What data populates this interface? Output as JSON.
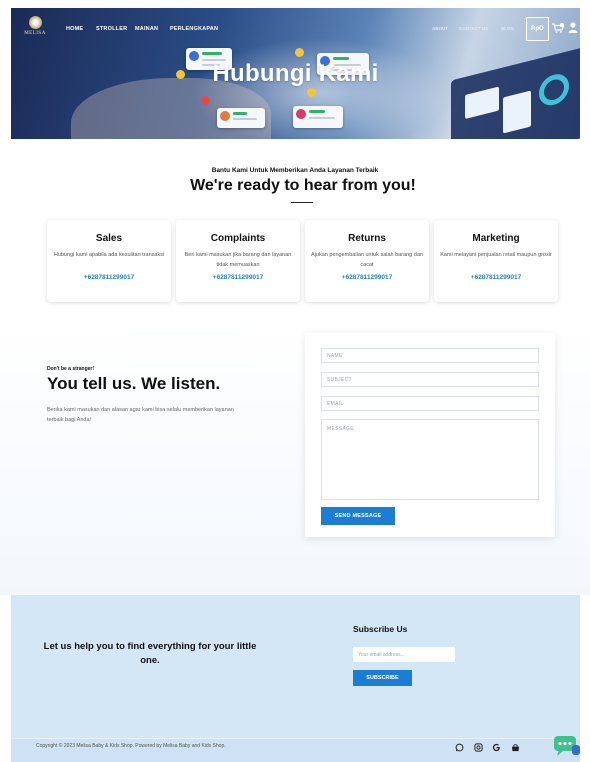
{
  "nav": {
    "logo_text": "MELISA",
    "links": [
      "HOME",
      "STROLLER",
      "MAINAN",
      "PERLENGKAPAN"
    ],
    "right_links": [
      "ABOUT",
      "CONTACT US",
      "BLOG"
    ],
    "lang": "RpO"
  },
  "hero": {
    "title": "Hubungi Kami"
  },
  "intro": {
    "kicker": "Bantu Kami Untuk Memberikan Anda Layanan Terbaik",
    "headline": "We're ready to hear from you!"
  },
  "cards": [
    {
      "title": "Sales",
      "desc": "Hubungi kami apabila ada kesulitan transaksi",
      "phone": "+6287811299017"
    },
    {
      "title": "Complaints",
      "desc": "Beri kami masukan jika barang dan layanan tidak memuaskan",
      "phone": "+6287811299017"
    },
    {
      "title": "Returns",
      "desc": "Ajukan pengembalian untuk salah barang dan cacat",
      "phone": "+6287811299017"
    },
    {
      "title": "Marketing",
      "desc": "Kami melayani penjualan retail maupun grosir",
      "phone": "+6287811299017"
    }
  ],
  "contact": {
    "kicker": "Don't be a stranger!",
    "title": "You tell us. We listen.",
    "desc": "Berika kami masukan dan alasan agar kami bisa selalu memberikan layanan terbaik bagi Anda!"
  },
  "form": {
    "name_placeholder": "NAME",
    "subject_placeholder": "SUBJECT",
    "email_placeholder": "EMAIL",
    "message_placeholder": "MESSAGE",
    "send_label": "SEND MESSAGE"
  },
  "subscribe": {
    "tagline": "Let us help you to find everything for your little one.",
    "title": "Subscribe Us",
    "placeholder": "Your email address...",
    "button": "SUBSCRIBE"
  },
  "footer": {
    "copyright": "Copyright © 2023 Melisa Baby & Kids Shop. Powered by Melisa Baby and Kids Shop."
  },
  "colors": {
    "accent": "#1c7dd3",
    "phone": "#2481c9",
    "subscribe_bg": "#d4e7f7"
  },
  "icons": [
    "cart-icon",
    "user-icon",
    "whatsapp-icon",
    "instagram-icon",
    "google-icon",
    "shop-icon",
    "chat-icon"
  ]
}
